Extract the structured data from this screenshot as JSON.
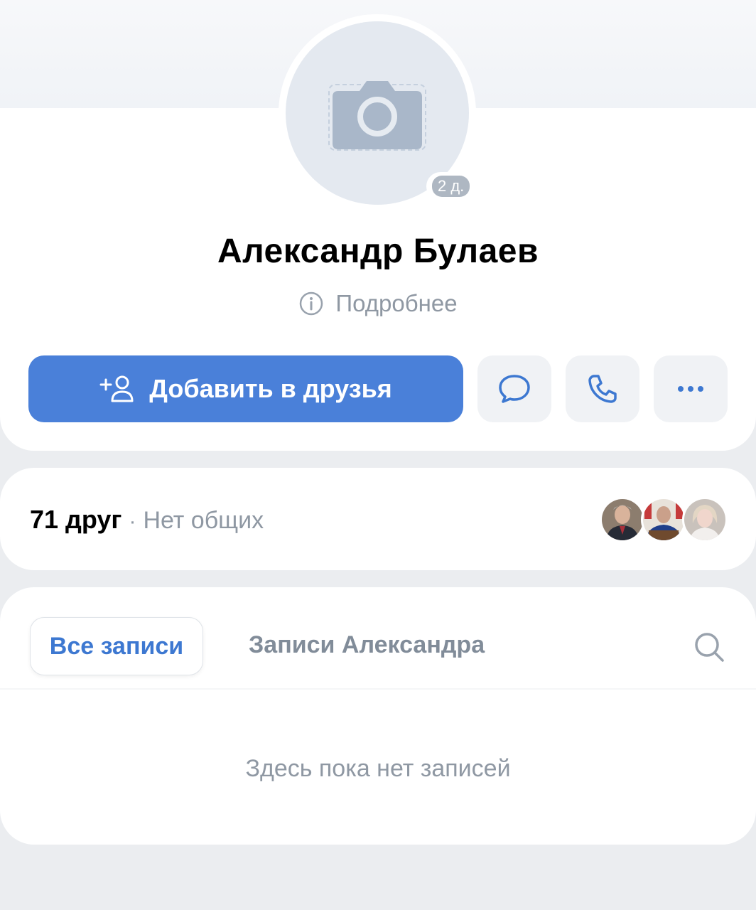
{
  "profile": {
    "name": "Александр Булаев",
    "online_badge": "2 д.",
    "details_label": "Подробнее",
    "avatar_placeholder_icon": "camera-icon"
  },
  "actions": {
    "add_friend_label": "Добавить в друзья",
    "add_friend_icon": "add-user-icon",
    "message_icon": "message-icon",
    "call_icon": "phone-icon",
    "more_icon": "more-icon"
  },
  "friends": {
    "count_label": "71 друг",
    "separator": "·",
    "mutual_label": "Нет общих",
    "avatars": [
      "friend-avatar-1",
      "friend-avatar-2",
      "friend-avatar-3"
    ]
  },
  "posts": {
    "tabs": [
      {
        "label": "Все записи",
        "active": true
      },
      {
        "label": "Записи Александра",
        "active": false
      }
    ],
    "empty_label": "Здесь пока нет записей",
    "search_icon": "search-icon"
  },
  "colors": {
    "accent": "#4a80d9",
    "tab_active_text": "#3d78d1",
    "secondary_text": "#8f98a3",
    "background": "#ebedf0"
  }
}
